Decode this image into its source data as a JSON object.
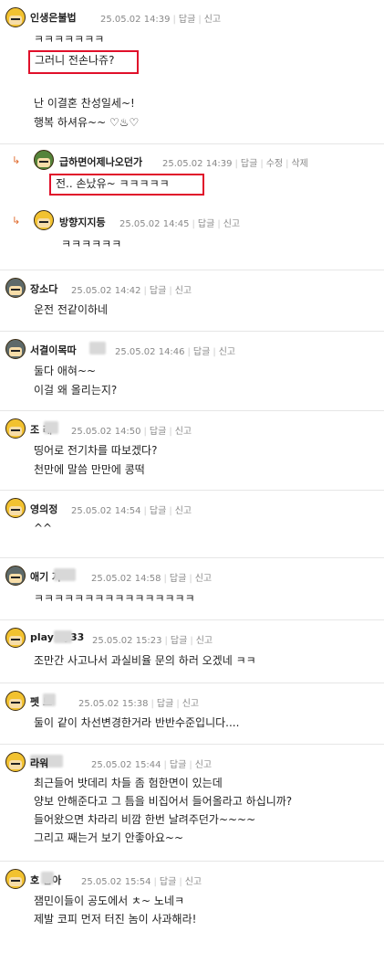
{
  "labels": {
    "reply": "답글",
    "report": "신고",
    "edit": "수정",
    "delete": "삭제"
  },
  "colors": {
    "highlight_box": "#e0102a",
    "reply_arrow": "#e06a2c",
    "meta_text": "#888888"
  },
  "comments": [
    {
      "nick": "인생은불법",
      "time": "25.05.02 14:39",
      "avatar": "yellow-character-icon",
      "lines": [
        "ㅋㅋㅋㅋㅋㅋㅋ",
        "그러니 전손나쥬?",
        "",
        "난 이결혼 찬성일세~!",
        "행복 하셔유~~ ♡♨♡"
      ],
      "highlighted_line": "그러니 전손나쥬?"
    },
    {
      "nick": "급하면어제나오던가",
      "time": "25.05.02 14:39",
      "avatar": "soldier-character-icon",
      "is_reply": true,
      "own": true,
      "lines": [
        "전.. 손났유~ ㅋㅋㅋㅋㅋ"
      ],
      "highlighted_line": "전.. 손났유~ ㅋㅋㅋㅋㅋ"
    },
    {
      "nick": "방향지지등",
      "time": "25.05.02 14:45",
      "avatar": "yellow-character-icon",
      "is_reply": true,
      "lines": [
        "ㅋㅋㅋㅋㅋㅋ"
      ]
    },
    {
      "nick": "장소다",
      "time": "25.05.02 14:42",
      "avatar": "helmet-character-icon",
      "lines": [
        "운전 전같이하네"
      ]
    },
    {
      "nick": "서결이목따",
      "time": "25.05.02 14:46",
      "avatar": "grey-character-icon",
      "lines": [
        "둘다 애혀~~",
        "이걸 왜 올리는지?"
      ]
    },
    {
      "nick": "조  래",
      "time": "25.05.02 14:50",
      "avatar": "yellow-character-icon",
      "lines": [
        "띵어로 전기차를 따보겠다?",
        "천만에 말씀 만만에 콩떡"
      ]
    },
    {
      "nick": "영의정",
      "time": "25.05.02 14:54",
      "avatar": "yellow-character-icon",
      "lines": [
        "^^"
      ]
    },
    {
      "nick": "애기    자",
      "time": "25.05.02 14:58",
      "avatar": "grey-character-icon",
      "lines": [
        "ㅋㅋㅋㅋㅋㅋㅋㅋㅋㅋㅋㅋㅋㅋㅋㅋ"
      ]
    },
    {
      "nick": "play    ay33",
      "time": "25.05.02 15:23",
      "avatar": "yellow-character-icon",
      "lines": [
        "조만간 사고나서 과실비율 문의 하러 오겠네 ㅋㅋ"
      ]
    },
    {
      "nick": "펫    브",
      "time": "25.05.02 15:38",
      "avatar": "yellow-character-icon",
      "lines": [
        "둘이 같이 차선변경한거라 반반수준입니다...."
      ]
    },
    {
      "nick": "     라워",
      "time": "25.05.02 15:44",
      "avatar": "yellow-character-icon",
      "lines": [
        "최근들어 밧데리 차들 좀 험한면이 있는데",
        "양보 안해준다고 그 틈을 비집어서 들어올라고 하십니까?",
        "들어왔으면 차라리 비깜 한번 날려주던가~~~~",
        "그리고 째는거 보기 안좋아요~~"
      ]
    },
    {
      "nick": "호    남아",
      "time": "25.05.02 15:54",
      "avatar": "yellow-character-icon",
      "lines": [
        "잼민이들이 공도에서 ㅊ~ 노네ㅋ",
        "제발 코피 먼저 터진 놈이 사과해라!"
      ]
    }
  ]
}
